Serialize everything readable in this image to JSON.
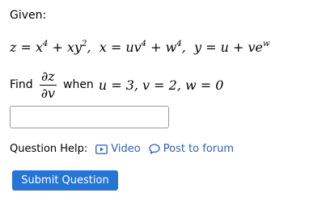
{
  "given_label": "Given:",
  "equation": {
    "z_lhs": "z",
    "z_rhs_a": "x",
    "z_rhs_a_exp": "4",
    "z_rhs_b": "xy",
    "z_rhs_b_exp": "2",
    "x_lhs": "x",
    "x_rhs_a": "uv",
    "x_rhs_a_exp": "4",
    "x_rhs_b": "w",
    "x_rhs_b_exp": "4",
    "y_lhs": "y",
    "y_rhs_a": "u",
    "y_rhs_b": "ve",
    "y_rhs_b_exp": "w"
  },
  "find": {
    "label": "Find",
    "numerator": "∂z",
    "denominator": "∂v",
    "when_label": "when",
    "conditions": "u = 3,  v = 2,  w = 0"
  },
  "answer": {
    "value": "",
    "placeholder": ""
  },
  "help": {
    "label": "Question Help:",
    "video_label": "Video",
    "video_icon": "video-icon",
    "forum_label": "Post to forum",
    "forum_icon": "speech-bubble-icon"
  },
  "submit_label": "Submit Question",
  "colors": {
    "link": "#2b5fc0",
    "button": "#2574d6",
    "button_text": "#ffffff"
  }
}
